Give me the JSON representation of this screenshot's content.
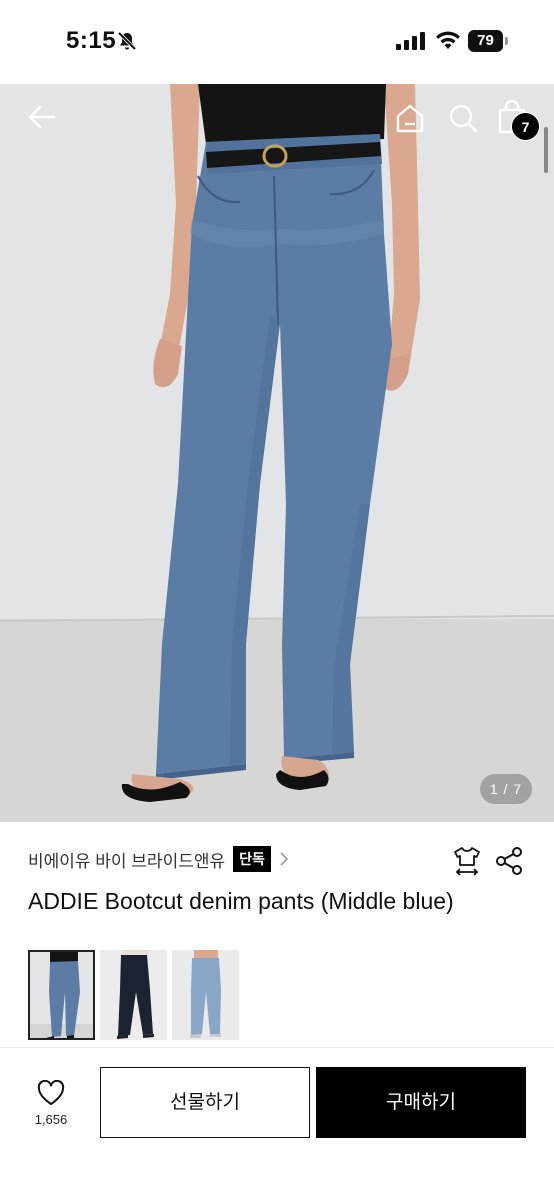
{
  "status_bar": {
    "time": "5:15",
    "battery": "79"
  },
  "header": {
    "cart_count": "7"
  },
  "gallery": {
    "counter": "1 / 7"
  },
  "product": {
    "brand": "비에이유 바이 브라이드앤유",
    "badge": "단독",
    "title": "ADDIE Bootcut denim pants (Middle blue)"
  },
  "bottom_bar": {
    "like_count": "1,656",
    "gift_label": "선물하기",
    "buy_label": "구매하기"
  },
  "colors": {
    "denim": "#5d7ea6",
    "accent": "#000000",
    "background": "#ffffff"
  }
}
